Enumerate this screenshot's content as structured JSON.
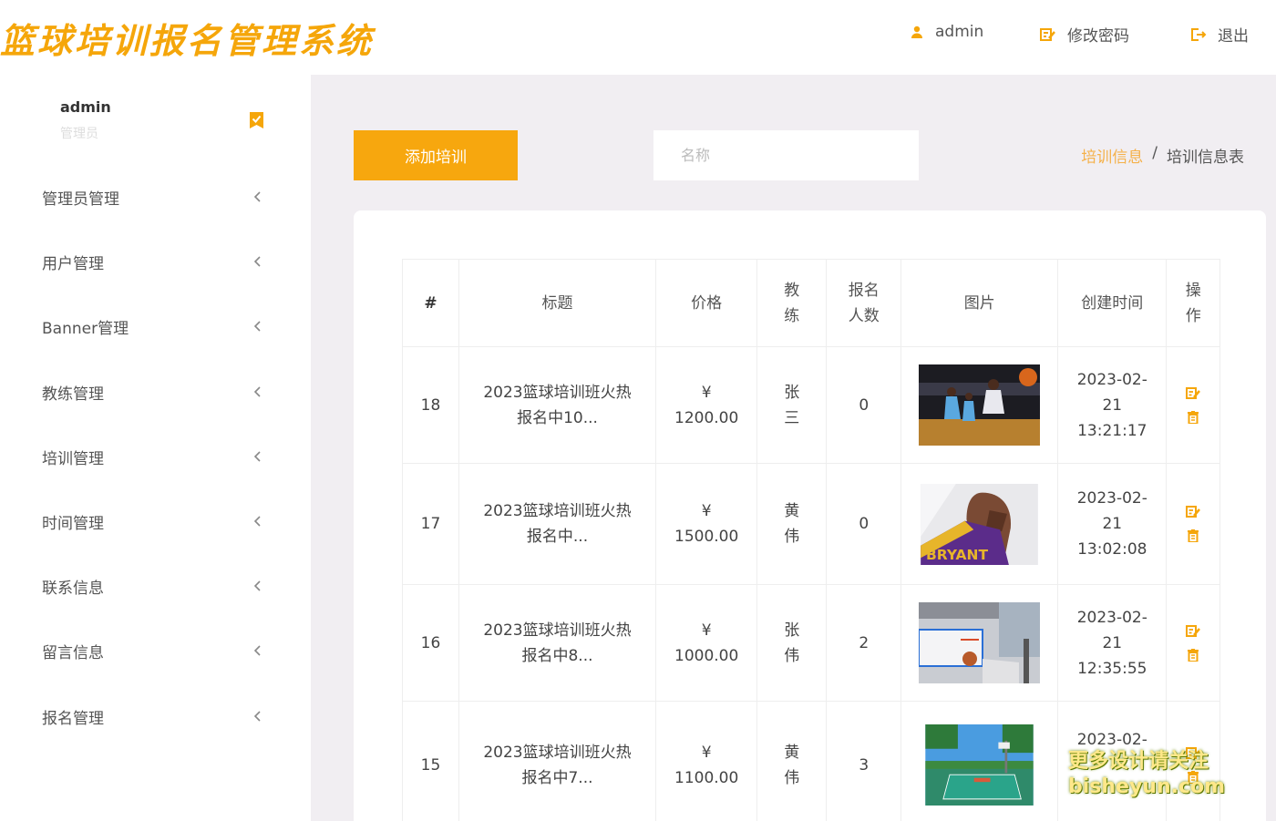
{
  "header": {
    "logo": "篮球培训报名管理系统",
    "user": "admin",
    "change_password": "修改密码",
    "logout": "退出",
    "accent_color": "#f5a60a"
  },
  "sidebar": {
    "user_name": "admin",
    "user_role": "管理员",
    "items": [
      {
        "label": "管理员管理"
      },
      {
        "label": "用户管理"
      },
      {
        "label": "Banner管理"
      },
      {
        "label": "教练管理"
      },
      {
        "label": "培训管理"
      },
      {
        "label": "时间管理"
      },
      {
        "label": "联系信息"
      },
      {
        "label": "留言信息"
      },
      {
        "label": "报名管理"
      }
    ]
  },
  "toolbar": {
    "add_label": "添加培训",
    "search_placeholder": "名称",
    "breadcrumb_parent": "培训信息",
    "breadcrumb_sep": "/",
    "breadcrumb_current": "培训信息表"
  },
  "table": {
    "headers": [
      "#",
      "标题",
      "价格",
      "教练",
      "报名人数",
      "图片",
      "创建时间",
      "操作"
    ],
    "rows": [
      {
        "id": "18",
        "title": "2023篮球培训班火热报名中10...",
        "price": "¥ 1200.00",
        "coach": "张三",
        "count": "0",
        "image": "basketball-game-photo",
        "created": "2023-02-21 13:21:17"
      },
      {
        "id": "17",
        "title": "2023篮球培训班火热报名中...",
        "price": "¥ 1500.00",
        "coach": "黄伟",
        "count": "0",
        "image": "player-portrait-photo",
        "created": "2023-02-21 13:02:08"
      },
      {
        "id": "16",
        "title": "2023篮球培训班火热报名中8...",
        "price": "¥ 1000.00",
        "coach": "张伟",
        "count": "2",
        "image": "basketball-hoop-photo",
        "created": "2023-02-21 12:35:55"
      },
      {
        "id": "15",
        "title": "2023篮球培训班火热报名中7...",
        "price": "¥ 1100.00",
        "coach": "黄伟",
        "count": "3",
        "image": "outdoor-court-photo",
        "created": "2023-02-"
      }
    ]
  },
  "watermark": {
    "line1": "更多设计请关注",
    "line2": "bisheyun.com"
  }
}
